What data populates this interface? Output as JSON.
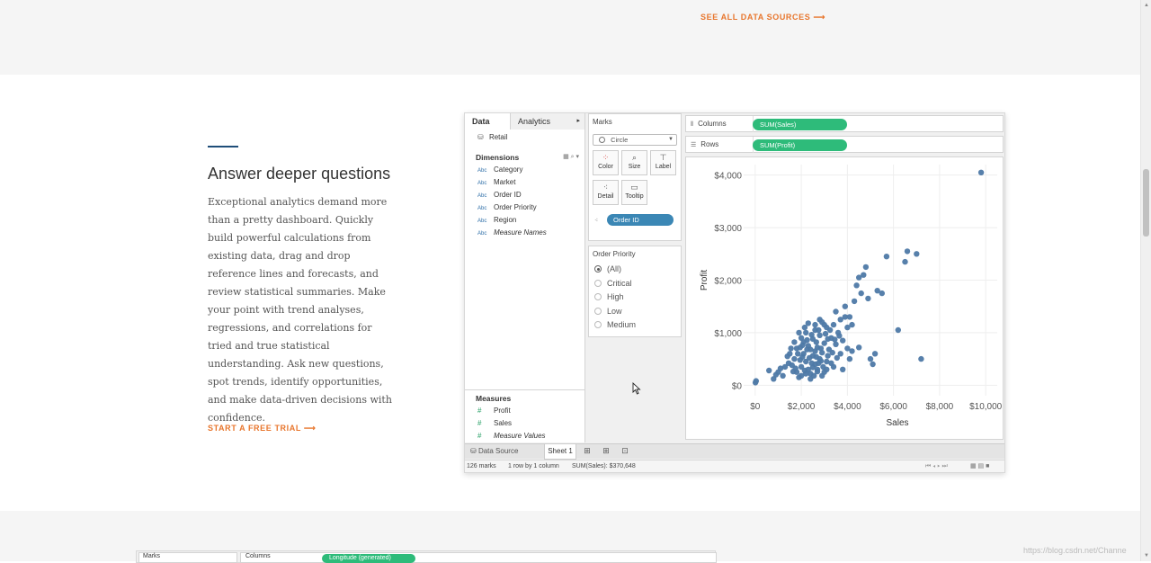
{
  "top_link": {
    "label": "SEE ALL DATA SOURCES ⟶"
  },
  "feature": {
    "title": "Answer deeper questions",
    "body": "Exceptional analytics demand more than a pretty dashboard. Quickly build powerful calculations from existing data, drag and drop reference lines and forecasts, and review statistical summaries. Make your point with trend analyses, regressions, and correlations for tried and true statistical understanding. Ask new questions, spot trends, identify opportunities, and make data-driven decisions with confidence.",
    "cta": "START A FREE TRIAL ⟶"
  },
  "tableau": {
    "tabs": {
      "data": "Data",
      "analytics": "Analytics"
    },
    "source": "Retail",
    "dimensions_header": "Dimensions",
    "dimensions": [
      {
        "type": "Abc",
        "name": "Category"
      },
      {
        "type": "Abc",
        "name": "Market"
      },
      {
        "type": "Abc",
        "name": "Order ID"
      },
      {
        "type": "Abc",
        "name": "Order Priority"
      },
      {
        "type": "Abc",
        "name": "Region"
      },
      {
        "type": "Abc",
        "name": "Measure Names"
      }
    ],
    "measures_header": "Measures",
    "measures": [
      {
        "type": "#",
        "name": "Profit"
      },
      {
        "type": "#",
        "name": "Sales"
      },
      {
        "type": "#",
        "name": "Measure Values"
      }
    ],
    "marks": {
      "title": "Marks",
      "mark_type": "Circle",
      "buttons": [
        "Color",
        "Size",
        "Label",
        "Detail",
        "Tooltip"
      ],
      "detail_pill": "Order ID"
    },
    "filter": {
      "title": "Order Priority",
      "options": [
        "(All)",
        "Critical",
        "High",
        "Low",
        "Medium"
      ],
      "selected": "(All)"
    },
    "shelves": {
      "columns_label": "Columns",
      "columns_pill": "SUM(Sales)",
      "rows_label": "Rows",
      "rows_pill": "SUM(Profit)"
    },
    "sheet_bar": {
      "data_source": "Data Source",
      "sheet": "Sheet 1"
    },
    "status": {
      "marks": "126 marks",
      "dims": "1 row by 1 column",
      "sum": "SUM(Sales): $370,648"
    }
  },
  "chart_data": {
    "type": "scatter",
    "title": "",
    "xlabel": "Sales",
    "ylabel": "Profit",
    "xlim": [
      -500,
      10500
    ],
    "ylim": [
      -200,
      4200
    ],
    "x_ticks": [
      "$0",
      "$2,000",
      "$4,000",
      "$6,000",
      "$8,000",
      "$10,000"
    ],
    "y_ticks": [
      "$0",
      "$1,000",
      "$2,000",
      "$3,000",
      "$4,000"
    ],
    "color": "#4e79a7",
    "points": [
      [
        10,
        50
      ],
      [
        40,
        80
      ],
      [
        600,
        280
      ],
      [
        800,
        120
      ],
      [
        900,
        200
      ],
      [
        1000,
        250
      ],
      [
        1100,
        320
      ],
      [
        1300,
        350
      ],
      [
        1400,
        550
      ],
      [
        1500,
        600
      ],
      [
        1600,
        380
      ],
      [
        1700,
        500
      ],
      [
        1800,
        700
      ],
      [
        1800,
        250
      ],
      [
        1900,
        150
      ],
      [
        2000,
        350
      ],
      [
        2000,
        900
      ],
      [
        2100,
        820
      ],
      [
        2100,
        600
      ],
      [
        2200,
        450
      ],
      [
        2200,
        1000
      ],
      [
        2300,
        750
      ],
      [
        2300,
        300
      ],
      [
        2400,
        680
      ],
      [
        2400,
        120
      ],
      [
        2500,
        560
      ],
      [
        2500,
        880
      ],
      [
        2600,
        400
      ],
      [
        2600,
        1050
      ],
      [
        2700,
        720
      ],
      [
        2700,
        300
      ],
      [
        2800,
        950
      ],
      [
        2800,
        500
      ],
      [
        2900,
        1200
      ],
      [
        2900,
        620
      ],
      [
        3000,
        800
      ],
      [
        3000,
        250
      ],
      [
        3100,
        1100
      ],
      [
        3100,
        450
      ],
      [
        3200,
        680
      ],
      [
        3300,
        900
      ],
      [
        3400,
        350
      ],
      [
        3400,
        1150
      ],
      [
        3500,
        780
      ],
      [
        3600,
        1000
      ],
      [
        3700,
        600
      ],
      [
        3800,
        300
      ],
      [
        3800,
        850
      ],
      [
        3900,
        1300
      ],
      [
        4000,
        700
      ],
      [
        4100,
        500
      ],
      [
        4200,
        1150
      ],
      [
        4300,
        1600
      ],
      [
        4400,
        1900
      ],
      [
        4500,
        2050
      ],
      [
        4600,
        1750
      ],
      [
        4700,
        2100
      ],
      [
        4800,
        2250
      ],
      [
        4900,
        1650
      ],
      [
        5000,
        500
      ],
      [
        5100,
        400
      ],
      [
        5200,
        600
      ],
      [
        5300,
        1800
      ],
      [
        5500,
        1750
      ],
      [
        5700,
        2450
      ],
      [
        6200,
        1050
      ],
      [
        6500,
        2350
      ],
      [
        6600,
        2550
      ],
      [
        7000,
        2500
      ],
      [
        7200,
        500
      ],
      [
        9800,
        4050
      ],
      [
        2400,
        220
      ],
      [
        2600,
        650
      ],
      [
        1950,
        480
      ],
      [
        2150,
        280
      ],
      [
        2350,
        520
      ],
      [
        2550,
        180
      ],
      [
        2750,
        420
      ],
      [
        2950,
        350
      ],
      [
        3150,
        560
      ],
      [
        1750,
        320
      ],
      [
        1850,
        600
      ],
      [
        2050,
        760
      ],
      [
        2250,
        860
      ],
      [
        2450,
        960
      ],
      [
        2650,
        820
      ],
      [
        2850,
        700
      ],
      [
        3050,
        980
      ],
      [
        3250,
        1050
      ],
      [
        3450,
        870
      ],
      [
        1200,
        180
      ],
      [
        1450,
        420
      ],
      [
        1650,
        260
      ],
      [
        2000,
        180
      ],
      [
        2200,
        220
      ],
      [
        2500,
        340
      ],
      [
        2700,
        260
      ],
      [
        2900,
        180
      ],
      [
        3100,
        300
      ],
      [
        3300,
        420
      ],
      [
        4200,
        650
      ],
      [
        4500,
        720
      ],
      [
        3700,
        1250
      ],
      [
        3500,
        1400
      ],
      [
        4000,
        1100
      ],
      [
        4100,
        1300
      ],
      [
        3900,
        1500
      ],
      [
        2600,
        1150
      ],
      [
        2800,
        1250
      ],
      [
        3000,
        1150
      ],
      [
        1900,
        1000
      ],
      [
        2150,
        1100
      ],
      [
        2300,
        1180
      ],
      [
        1700,
        820
      ],
      [
        1550,
        700
      ],
      [
        2050,
        540
      ],
      [
        2650,
        540
      ],
      [
        2850,
        460
      ],
      [
        3350,
        620
      ],
      [
        3550,
        520
      ],
      [
        2250,
        680
      ],
      [
        2450,
        420
      ],
      [
        1950,
        720
      ],
      [
        2750,
        1050
      ],
      [
        3150,
        880
      ],
      [
        3650,
        940
      ]
    ]
  },
  "watermark": "https://blog.csdn.net/Channe",
  "peek": {
    "marks": "Marks",
    "columns": "Columns",
    "pill": "Longitude (generated)"
  }
}
